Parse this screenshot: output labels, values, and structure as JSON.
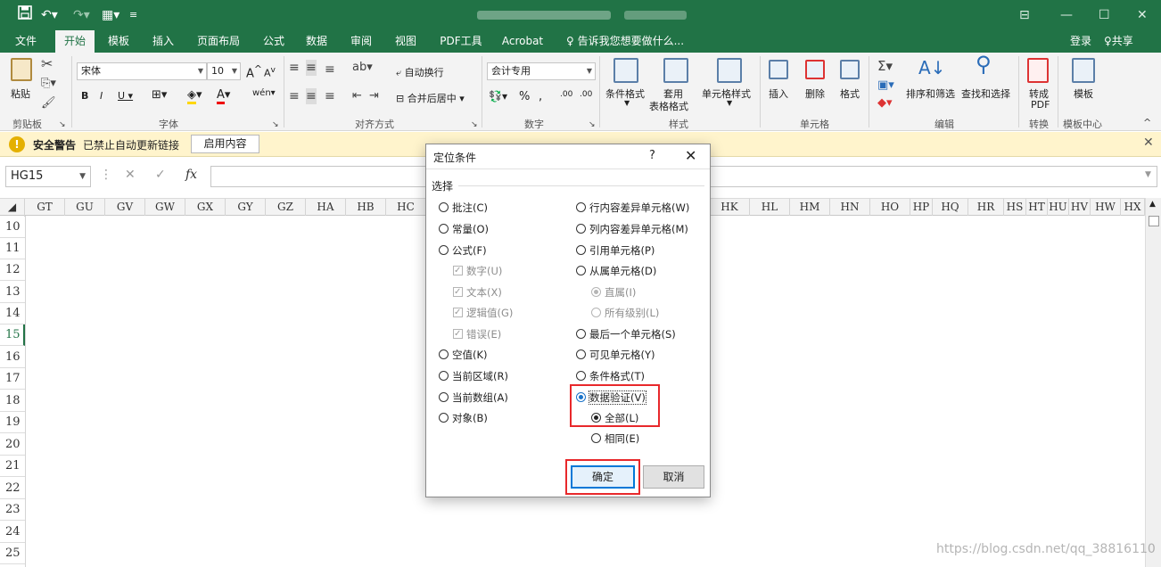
{
  "titlebar": {
    "qa_save_icon": "save-icon",
    "qa_undo_icon": "undo-icon",
    "qa_redo_icon": "redo-icon",
    "window_controls": [
      "⊟",
      "—",
      "☐",
      "✕"
    ]
  },
  "tabs": [
    "文件",
    "开始",
    "模板",
    "插入",
    "页面布局",
    "公式",
    "数据",
    "审阅",
    "视图",
    "PDF工具",
    "Acrobat"
  ],
  "active_tab": "开始",
  "tell_me": "告诉我您想要做什么...",
  "sign_in": "登录",
  "share": "共享",
  "ribbon": {
    "paste": "粘贴",
    "font_name": "宋体",
    "font_size": "10",
    "wrap_text": "自动换行",
    "merge_center": "合并后居中",
    "number_format": "会计专用",
    "cond_format": "条件格式",
    "table_style_1": "套用",
    "table_style_2": "表格格式",
    "cell_styles": "单元格样式",
    "insert": "插入",
    "delete": "删除",
    "format": "格式",
    "sort_filter": "排序和筛选",
    "find_select": "查找和选择",
    "convert_pdf_1": "转成",
    "convert_pdf_2": "PDF",
    "template": "模板",
    "groups": [
      "剪贴板",
      "字体",
      "对齐方式",
      "数字",
      "样式",
      "单元格",
      "编辑",
      "转换",
      "模板中心"
    ]
  },
  "security": {
    "title": "安全警告",
    "message": "已禁止自动更新链接",
    "button": "启用内容"
  },
  "formula_bar": {
    "name_box": "HG15",
    "fx": "fx"
  },
  "columns_left": [
    "GT",
    "GU",
    "GV",
    "GW",
    "GX",
    "GY",
    "GZ",
    "HA",
    "HB",
    "HC"
  ],
  "columns_right": [
    "HK",
    "HL",
    "HM",
    "HN",
    "HO",
    "HP",
    "HQ",
    "HR",
    "HS",
    "HT",
    "HU",
    "HV",
    "HW",
    "HX"
  ],
  "rows": [
    "10",
    "11",
    "12",
    "13",
    "14",
    "15",
    "16",
    "17",
    "18",
    "19",
    "20",
    "21",
    "22",
    "23",
    "24",
    "25"
  ],
  "selected_row": "15",
  "watermark": "https://blog.csdn.net/qq_38816110",
  "dialog": {
    "title": "定位条件",
    "help": "?",
    "section": "选择",
    "left_options": [
      {
        "label": "批注(C)",
        "type": "radio",
        "checked": false,
        "disabled": false
      },
      {
        "label": "常量(O)",
        "type": "radio",
        "checked": false,
        "disabled": false
      },
      {
        "label": "公式(F)",
        "type": "radio",
        "checked": false,
        "disabled": false
      },
      {
        "label": "数字(U)",
        "type": "check",
        "checked": true,
        "disabled": true
      },
      {
        "label": "文本(X)",
        "type": "check",
        "checked": true,
        "disabled": true
      },
      {
        "label": "逻辑值(G)",
        "type": "check",
        "checked": true,
        "disabled": true
      },
      {
        "label": "错误(E)",
        "type": "check",
        "checked": true,
        "disabled": true
      },
      {
        "label": "空值(K)",
        "type": "radio",
        "checked": false,
        "disabled": false
      },
      {
        "label": "当前区域(R)",
        "type": "radio",
        "checked": false,
        "disabled": false
      },
      {
        "label": "当前数组(A)",
        "type": "radio",
        "checked": false,
        "disabled": false
      },
      {
        "label": "对象(B)",
        "type": "radio",
        "checked": false,
        "disabled": false
      }
    ],
    "right_options": [
      {
        "label": "行内容差异单元格(W)",
        "type": "radio",
        "checked": false,
        "disabled": false
      },
      {
        "label": "列内容差异单元格(M)",
        "type": "radio",
        "checked": false,
        "disabled": false
      },
      {
        "label": "引用单元格(P)",
        "type": "radio",
        "checked": false,
        "disabled": false
      },
      {
        "label": "从属单元格(D)",
        "type": "radio",
        "checked": false,
        "disabled": false
      },
      {
        "label": "直属(I)",
        "type": "radio",
        "checked": true,
        "disabled": true
      },
      {
        "label": "所有级别(L)",
        "type": "radio",
        "checked": false,
        "disabled": true
      },
      {
        "label": "最后一个单元格(S)",
        "type": "radio",
        "checked": false,
        "disabled": false
      },
      {
        "label": "可见单元格(Y)",
        "type": "radio",
        "checked": false,
        "disabled": false
      },
      {
        "label": "条件格式(T)",
        "type": "radio",
        "checked": false,
        "disabled": false
      },
      {
        "label": "数据验证(V)",
        "type": "radio",
        "checked": true,
        "disabled": false
      },
      {
        "label": "全部(L)",
        "type": "radio",
        "checked": true,
        "disabled": false
      },
      {
        "label": "相同(E)",
        "type": "radio",
        "checked": false,
        "disabled": false
      }
    ],
    "ok": "确定",
    "cancel": "取消"
  }
}
